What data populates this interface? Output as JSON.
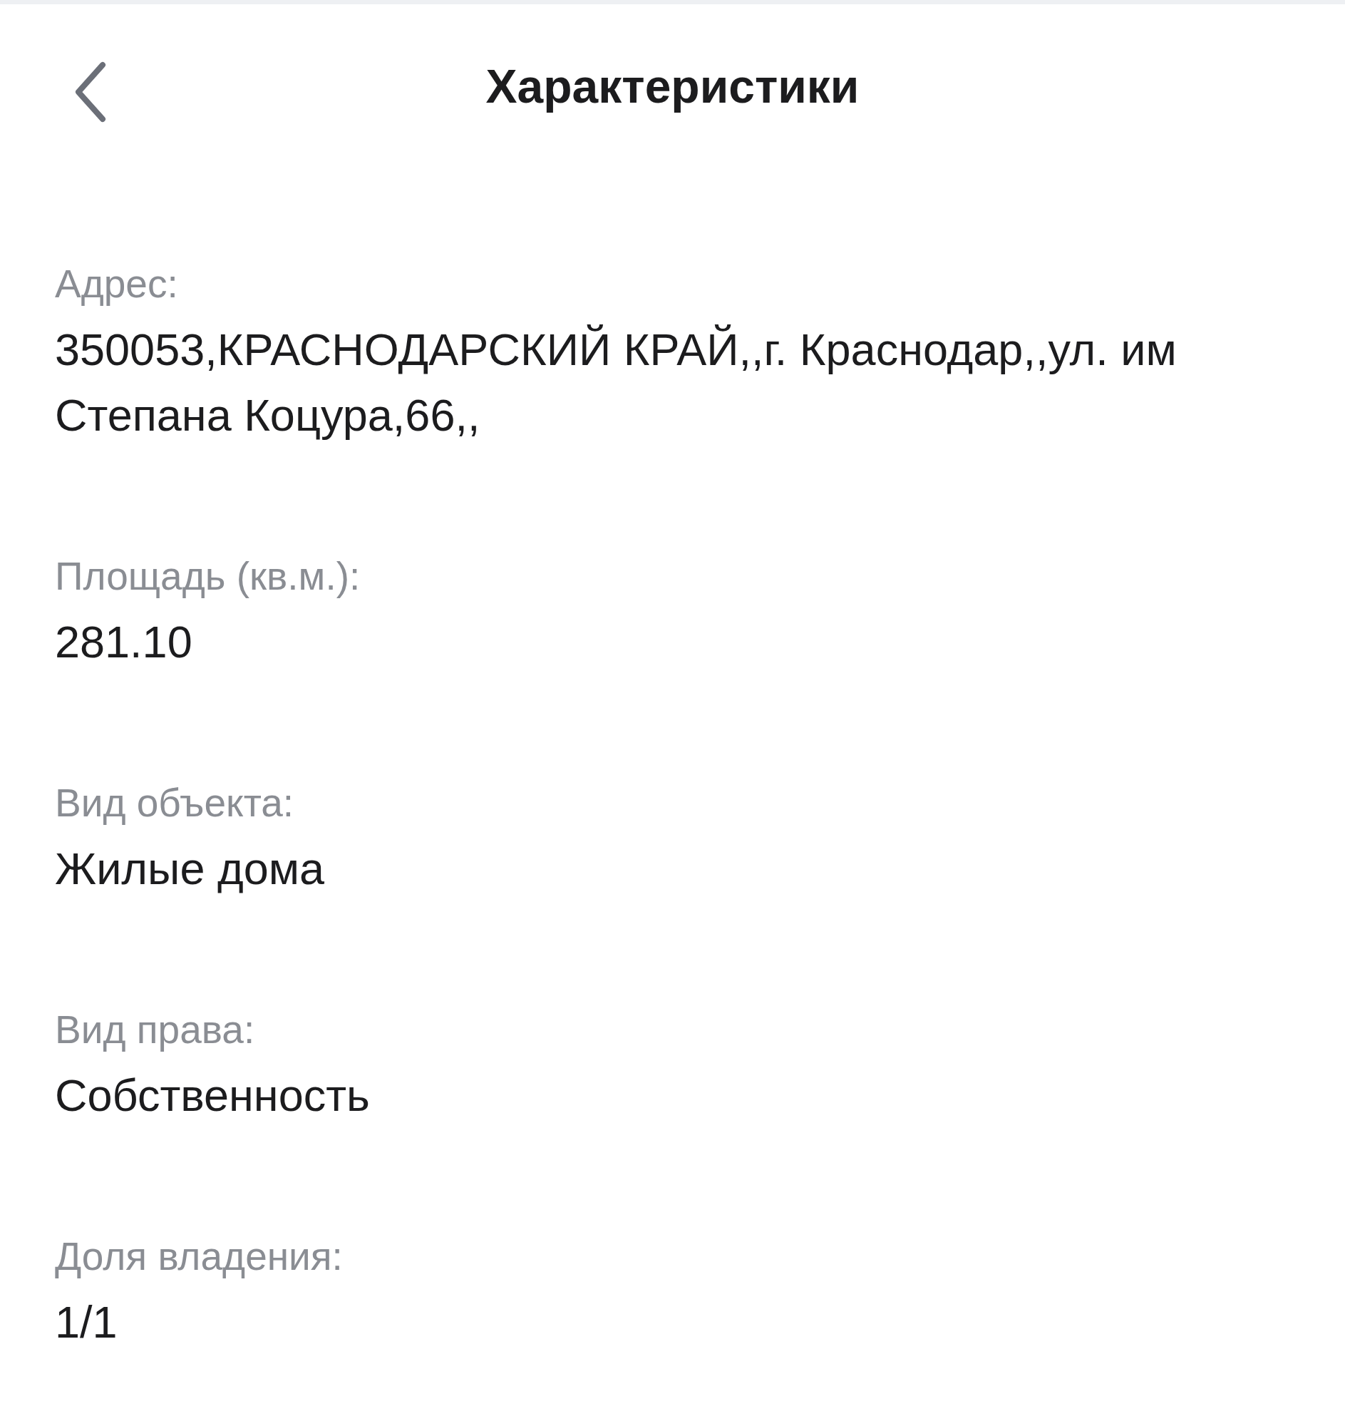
{
  "header": {
    "title": "Характеристики"
  },
  "fields": [
    {
      "label": "Адрес:",
      "value": "350053,КРАСНОДАРСКИЙ КРАЙ,,г. Краснодар,,ул. им Степана Коцура,66,,"
    },
    {
      "label": "Площадь (кв.м.):",
      "value": "281.10"
    },
    {
      "label": "Вид объекта:",
      "value": "Жилые дома"
    },
    {
      "label": "Вид права:",
      "value": "Собственность"
    },
    {
      "label": "Доля владения:",
      "value": "1/1"
    }
  ]
}
